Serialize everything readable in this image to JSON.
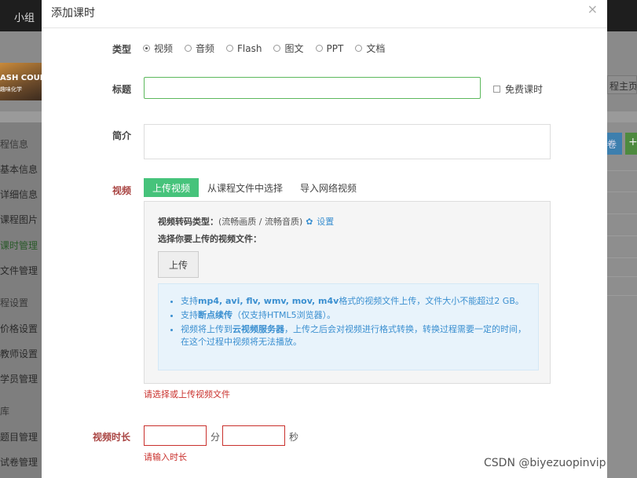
{
  "background": {
    "nav_group": "小组",
    "thumb_title": "ASH COURSE",
    "thumb_sub": "趣味化学",
    "course_home": "程主页",
    "action_blue": "卷",
    "action_green": "+",
    "sidebar": [
      {
        "label": "程信息",
        "type": "head"
      },
      {
        "label": "基本信息",
        "type": "item"
      },
      {
        "label": "详细信息",
        "type": "item"
      },
      {
        "label": "课程图片",
        "type": "item"
      },
      {
        "label": "课时管理",
        "type": "active"
      },
      {
        "label": "文件管理",
        "type": "item"
      },
      {
        "label": "程设置",
        "type": "head"
      },
      {
        "label": "价格设置",
        "type": "item"
      },
      {
        "label": "教师设置",
        "type": "item"
      },
      {
        "label": "学员管理",
        "type": "item"
      },
      {
        "label": "库",
        "type": "head"
      },
      {
        "label": "题目管理",
        "type": "item"
      },
      {
        "label": "试卷管理",
        "type": "item"
      }
    ]
  },
  "modal": {
    "title": "添加课时",
    "close": "×",
    "type_label": "类型",
    "type_options": [
      {
        "label": "视频",
        "checked": true
      },
      {
        "label": "音频",
        "checked": false
      },
      {
        "label": "Flash",
        "checked": false
      },
      {
        "label": "图文",
        "checked": false
      },
      {
        "label": "PPT",
        "checked": false
      },
      {
        "label": "文档",
        "checked": false
      }
    ],
    "title_label": "标题",
    "title_value": "",
    "free_label": "免费课时",
    "summary_label": "简介",
    "summary_value": "",
    "video_label": "视频",
    "tabs": [
      {
        "label": "上传视频",
        "active": true
      },
      {
        "label": "从课程文件中选择",
        "active": false
      },
      {
        "label": "导入网络视频",
        "active": false
      }
    ],
    "transcode_key": "视频转码类型：",
    "transcode_value": "(流畅画质 / 流畅音质)",
    "settings_label": "设置",
    "choose_text": "选择你要上传的视频文件：",
    "upload_button": "上传",
    "info_items": [
      {
        "pre": "支持",
        "bold": "mp4, avi, flv, wmv, mov, m4v",
        "post": "格式的视频文件上传，文件大小不能超过2 GB。"
      },
      {
        "pre": "支持",
        "bold": "断点续传",
        "post": "（仅支持HTML5浏览器）。"
      },
      {
        "pre": "视频将上传到",
        "bold": "云视频服务器",
        "post": "，上传之后会对视频进行格式转换，转换过程需要一定的时间，在这个过程中视频将无法播放。"
      }
    ],
    "video_error": "请选择或上传视频文件",
    "duration_label": "视频时长",
    "minutes_value": "",
    "minutes_unit": "分",
    "seconds_value": "",
    "seconds_unit": "秒",
    "duration_error": "请输入时长"
  },
  "watermark": "CSDN @biyezuopinvip",
  "colors": {
    "accent_green": "#46c37b",
    "error_red": "#c9302c",
    "info_blue": "#3a8fd0"
  }
}
